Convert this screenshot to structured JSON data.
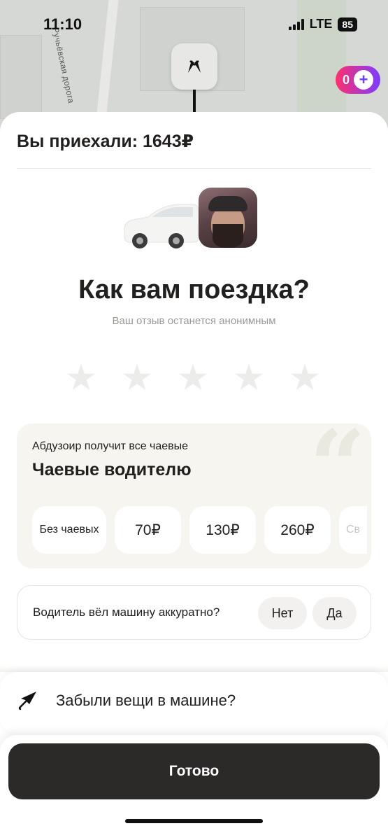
{
  "status_bar": {
    "time": "11:10",
    "network": "LTE",
    "battery": "85"
  },
  "map": {
    "street_label": "Ручьёвская дорога"
  },
  "plus_badge": {
    "count": "0",
    "icon": "plus-icon"
  },
  "header": {
    "arrived_text": "Вы приехали: 1643₽"
  },
  "rating": {
    "question": "Как вам поездка?",
    "anon_note": "Ваш отзыв останется анонимным",
    "stars": 5,
    "selected": 0
  },
  "tips": {
    "subtitle": "Абдузоир получит все чаевые",
    "title": "Чаевые водителю",
    "options": [
      "Без чаевых",
      "70₽",
      "130₽",
      "260₽",
      "Св"
    ]
  },
  "careful": {
    "question": "Водитель вёл машину аккуратно?",
    "no": "Нет",
    "yes": "Да"
  },
  "forgot": {
    "label": "Забыли вещи в машине?"
  },
  "done": {
    "label": "Готово"
  },
  "colors": {
    "primary_button": "#2b2a28",
    "tips_bg": "#f7f5ef",
    "plus_gradient_start": "#ff2f6d",
    "plus_gradient_end": "#7b3cff"
  }
}
